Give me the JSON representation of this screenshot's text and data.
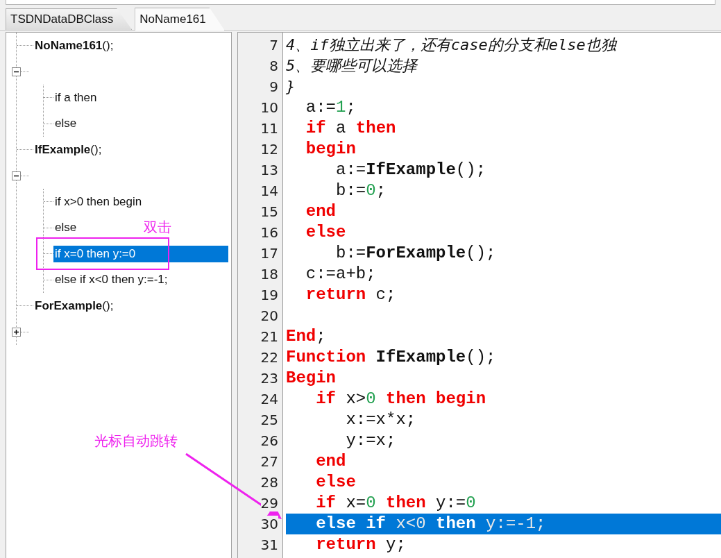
{
  "tabs": [
    {
      "label": "TSDNDataDBClass",
      "selected": false
    },
    {
      "label": "NoName161",
      "selected": true
    }
  ],
  "outline": {
    "nodes": [
      {
        "kind": "function",
        "label": "**NoName161**();",
        "selected": false
      },
      {
        "kind": "group",
        "expanded": true,
        "children": [
          {
            "label": "if a then",
            "selected": false
          },
          {
            "label": "else",
            "selected": false
          }
        ]
      },
      {
        "kind": "function",
        "label": "**IfExample**();",
        "selected": false
      },
      {
        "kind": "group",
        "expanded": true,
        "children": [
          {
            "label": "if x>0 then begin",
            "selected": false
          },
          {
            "label": "else",
            "selected": false
          },
          {
            "label": "if x=0 then y:=0",
            "selected": true
          },
          {
            "label": "else if x<0 then y:=-1;",
            "selected": false
          }
        ]
      },
      {
        "kind": "function",
        "label": "**ForExample**();",
        "selected": false
      },
      {
        "kind": "group",
        "expanded": false
      }
    ]
  },
  "editor": {
    "lines": [
      {
        "number": "7",
        "selected": false,
        "tokens": [
          {
            "kind": "comment",
            "text": "4、if独立出来了，还有case的分支和else也独"
          }
        ]
      },
      {
        "number": "8",
        "selected": false,
        "tokens": [
          {
            "kind": "comment",
            "text": "5、要哪些可以选择"
          }
        ]
      },
      {
        "number": "9",
        "selected": false,
        "tokens": [
          {
            "kind": "comment",
            "text": "}"
          }
        ]
      },
      {
        "number": "10",
        "selected": false,
        "tokens": [
          {
            "kind": "plain",
            "text": "  a:="
          },
          {
            "kind": "number",
            "text": "1"
          },
          {
            "kind": "plain",
            "text": ";"
          }
        ]
      },
      {
        "number": "11",
        "selected": false,
        "tokens": [
          {
            "kind": "keyword",
            "text": "  if"
          },
          {
            "kind": "plain",
            "text": " a "
          },
          {
            "kind": "keyword",
            "text": "then"
          }
        ]
      },
      {
        "number": "12",
        "selected": false,
        "tokens": [
          {
            "kind": "keyword",
            "text": "  begin"
          }
        ]
      },
      {
        "number": "13",
        "selected": false,
        "tokens": [
          {
            "kind": "plain",
            "text": "     a:="
          },
          {
            "kind": "function",
            "text": "IfExample"
          },
          {
            "kind": "plain",
            "text": "();"
          }
        ]
      },
      {
        "number": "14",
        "selected": false,
        "tokens": [
          {
            "kind": "plain",
            "text": "     b:="
          },
          {
            "kind": "number",
            "text": "0"
          },
          {
            "kind": "plain",
            "text": ";"
          }
        ]
      },
      {
        "number": "15",
        "selected": false,
        "tokens": [
          {
            "kind": "keyword",
            "text": "  end"
          }
        ]
      },
      {
        "number": "16",
        "selected": false,
        "tokens": [
          {
            "kind": "keyword",
            "text": "  else"
          }
        ]
      },
      {
        "number": "17",
        "selected": false,
        "tokens": [
          {
            "kind": "plain",
            "text": "     b:="
          },
          {
            "kind": "function",
            "text": "ForExample"
          },
          {
            "kind": "plain",
            "text": "();"
          }
        ]
      },
      {
        "number": "18",
        "selected": false,
        "tokens": [
          {
            "kind": "plain",
            "text": "  c:=a+b;"
          }
        ]
      },
      {
        "number": "19",
        "selected": false,
        "tokens": [
          {
            "kind": "keyword",
            "text": "  return"
          },
          {
            "kind": "plain",
            "text": " c;"
          }
        ]
      },
      {
        "number": "20",
        "selected": false
      },
      {
        "number": "21",
        "selected": false,
        "tokens": [
          {
            "kind": "keyword",
            "text": "End"
          },
          {
            "kind": "plain",
            "text": ";"
          }
        ]
      },
      {
        "number": "22",
        "selected": false,
        "tokens": [
          {
            "kind": "keyword",
            "text": "Function"
          },
          {
            "kind": "function",
            "text": " IfExample"
          },
          {
            "kind": "plain",
            "text": "();"
          }
        ]
      },
      {
        "number": "23",
        "selected": false,
        "tokens": [
          {
            "kind": "keyword",
            "text": "Begin"
          }
        ]
      },
      {
        "number": "24",
        "selected": false,
        "tokens": [
          {
            "kind": "keyword",
            "text": "   if"
          },
          {
            "kind": "plain",
            "text": " x>"
          },
          {
            "kind": "number",
            "text": "0"
          },
          {
            "kind": "keyword",
            "text": " then begin"
          }
        ]
      },
      {
        "number": "25",
        "selected": false,
        "tokens": [
          {
            "kind": "plain",
            "text": "      x:=x*x;"
          }
        ]
      },
      {
        "number": "26",
        "selected": false,
        "tokens": [
          {
            "kind": "plain",
            "text": "      y:=x;"
          }
        ]
      },
      {
        "number": "27",
        "selected": false,
        "tokens": [
          {
            "kind": "keyword",
            "text": "   end"
          }
        ]
      },
      {
        "number": "28",
        "selected": false,
        "tokens": [
          {
            "kind": "keyword",
            "text": "   else"
          }
        ]
      },
      {
        "number": "29",
        "selected": false,
        "tokens": [
          {
            "kind": "keyword",
            "text": "   if"
          },
          {
            "kind": "plain",
            "text": " x="
          },
          {
            "kind": "number",
            "text": "0"
          },
          {
            "kind": "keyword",
            "text": " then"
          },
          {
            "kind": "plain",
            "text": " y:="
          },
          {
            "kind": "number",
            "text": "0"
          }
        ]
      },
      {
        "number": "30",
        "selected": true,
        "tokens": [
          {
            "kind": "keyword",
            "text": "   else if"
          },
          {
            "kind": "plain",
            "text": " x<"
          },
          {
            "kind": "number",
            "text": "0"
          },
          {
            "kind": "keyword",
            "text": " then"
          },
          {
            "kind": "plain",
            "text": " y:=-"
          },
          {
            "kind": "number",
            "text": "1"
          },
          {
            "kind": "plain",
            "text": ";"
          }
        ]
      },
      {
        "number": "31",
        "selected": false,
        "tokens": [
          {
            "kind": "keyword",
            "text": "   return"
          },
          {
            "kind": "plain",
            "text": " y;"
          }
        ]
      }
    ]
  },
  "annotations": {
    "double_click_note": "双击",
    "jump_note": "光标自动跳转"
  }
}
